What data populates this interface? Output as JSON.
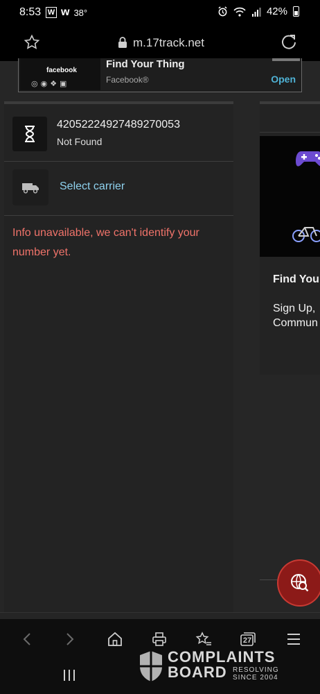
{
  "status_bar": {
    "time": "8:53",
    "icon_w_boxed": "W",
    "icon_w2": "w",
    "temperature": "38°",
    "battery": "42%"
  },
  "browser": {
    "url": "m.17track.net"
  },
  "ad": {
    "thumb_text": "facebook",
    "title": "Find Your Thing",
    "advertiser": "Facebook®",
    "cta": "Open"
  },
  "tracking": {
    "number": "42052224927489270053",
    "status": "Not Found",
    "carrier_link": "Select carrier",
    "message": "Info unavailable, we can't identify your number yet."
  },
  "side_ad": {
    "title": "Find You",
    "body_line1": "Sign Up,",
    "body_line2": "Commun"
  },
  "nav": {
    "tab_count": "27"
  },
  "watermark": {
    "line1": "COMPLAINTS",
    "line2": "BOARD",
    "tag1": "RESOLVING",
    "tag2": "SINCE 2004"
  }
}
